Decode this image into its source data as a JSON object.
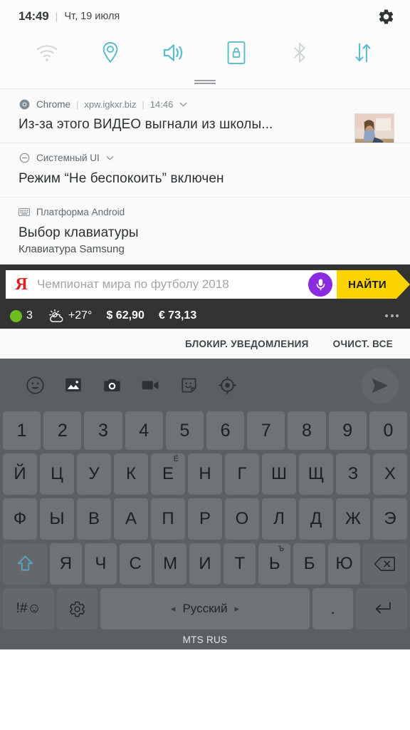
{
  "status_bar": {
    "time": "14:49",
    "separator": "|",
    "date": "Чт, 19 июля",
    "settings_icon": "gear-icon"
  },
  "quick_settings": {
    "toggles": [
      {
        "name": "wifi",
        "icon": "wifi-icon",
        "enabled": false,
        "color": "#cfd6da"
      },
      {
        "name": "location",
        "icon": "location-pin-icon",
        "enabled": true,
        "color": "#5bbccc"
      },
      {
        "name": "sound",
        "icon": "volume-icon",
        "enabled": true,
        "color": "#5bbccc"
      },
      {
        "name": "rotate_lock",
        "icon": "screen-lock-icon",
        "enabled": true,
        "color": "#5bbccc"
      },
      {
        "name": "bluetooth",
        "icon": "bluetooth-icon",
        "enabled": false,
        "color": "#cfd6da"
      },
      {
        "name": "mobile_data",
        "icon": "data-arrows-icon",
        "enabled": true,
        "color": "#5bbccc"
      }
    ],
    "handle": "drag-handle"
  },
  "notifications": [
    {
      "app": "Chrome",
      "app_icon": "chrome-icon",
      "source": "xpw.igkxr.biz",
      "time": "14:46",
      "title": "Из-за этого ВИДЕО выгнали из школы...",
      "body": "",
      "has_thumbnail": true,
      "expand_icon": "chevron-down-icon",
      "divider": "|"
    },
    {
      "app": "Системный UI",
      "app_icon": "do-not-disturb-icon",
      "source": "",
      "time": "",
      "title": "Режим “Не беспокоить” включен",
      "body": "",
      "has_thumbnail": false,
      "expand_icon": "chevron-down-icon",
      "divider": ""
    },
    {
      "app": "Платформа Android",
      "app_icon": "keyboard-icon",
      "source": "",
      "time": "",
      "title": "Выбор клавиатуры",
      "body": "Клавиатура Samsung",
      "has_thumbnail": false,
      "expand_icon": "",
      "divider": ""
    }
  ],
  "yandex_widget": {
    "logo": "Я",
    "logo_color": "#dd1f1f",
    "query": "Чемпионат мира по футболу 2018",
    "mic_icon": "microphone-icon",
    "mic_color": "#8a2be2",
    "search_button": "НАЙТИ",
    "search_button_color": "#fbd400",
    "traffic_score": "3",
    "traffic_color": "#6abf1e",
    "weather_icon": "sun-cloud-icon",
    "temperature": "+27°",
    "usd": "$ 62,90",
    "eur": "€ 73,13",
    "overflow_icon": "more-dots-icon"
  },
  "notification_actions": {
    "block": "БЛОКИР. УВЕДОМЛЕНИЯ",
    "clear_all": "ОЧИСТ. ВСЕ"
  },
  "keyboard": {
    "toolbar": [
      {
        "icon": "emoji-icon"
      },
      {
        "icon": "gallery-icon"
      },
      {
        "icon": "camera-icon"
      },
      {
        "icon": "video-icon"
      },
      {
        "icon": "sticker-icon"
      },
      {
        "icon": "location-target-icon"
      }
    ],
    "send_icon": "send-icon",
    "rows": {
      "numbers": [
        "1",
        "2",
        "3",
        "4",
        "5",
        "6",
        "7",
        "8",
        "9",
        "0"
      ],
      "row1": [
        {
          "label": "Й"
        },
        {
          "label": "Ц"
        },
        {
          "label": "У"
        },
        {
          "label": "К"
        },
        {
          "label": "Е",
          "sup": "Ё"
        },
        {
          "label": "Н"
        },
        {
          "label": "Г"
        },
        {
          "label": "Ш"
        },
        {
          "label": "Щ"
        },
        {
          "label": "З"
        },
        {
          "label": "Х"
        }
      ],
      "row2": [
        {
          "label": "Ф"
        },
        {
          "label": "Ы"
        },
        {
          "label": "В"
        },
        {
          "label": "А"
        },
        {
          "label": "П"
        },
        {
          "label": "Р"
        },
        {
          "label": "О"
        },
        {
          "label": "Л"
        },
        {
          "label": "Д"
        },
        {
          "label": "Ж"
        },
        {
          "label": "Э"
        }
      ],
      "row3": [
        {
          "label": "Я"
        },
        {
          "label": "Ч"
        },
        {
          "label": "С"
        },
        {
          "label": "М"
        },
        {
          "label": "И"
        },
        {
          "label": "Т"
        },
        {
          "label": "Ь",
          "sup": "Ъ"
        },
        {
          "label": "Б"
        },
        {
          "label": "Ю"
        }
      ]
    },
    "shift_icon": "shift-up-icon",
    "backspace_icon": "backspace-icon",
    "symbols_key": "!#☺",
    "settings_icon": "keyboard-settings-icon",
    "space_label": "Русский",
    "space_arrow_left": "◂",
    "space_arrow_right": "▸",
    "period_key": ".",
    "enter_icon": "enter-icon",
    "carrier": "MTS RUS"
  }
}
